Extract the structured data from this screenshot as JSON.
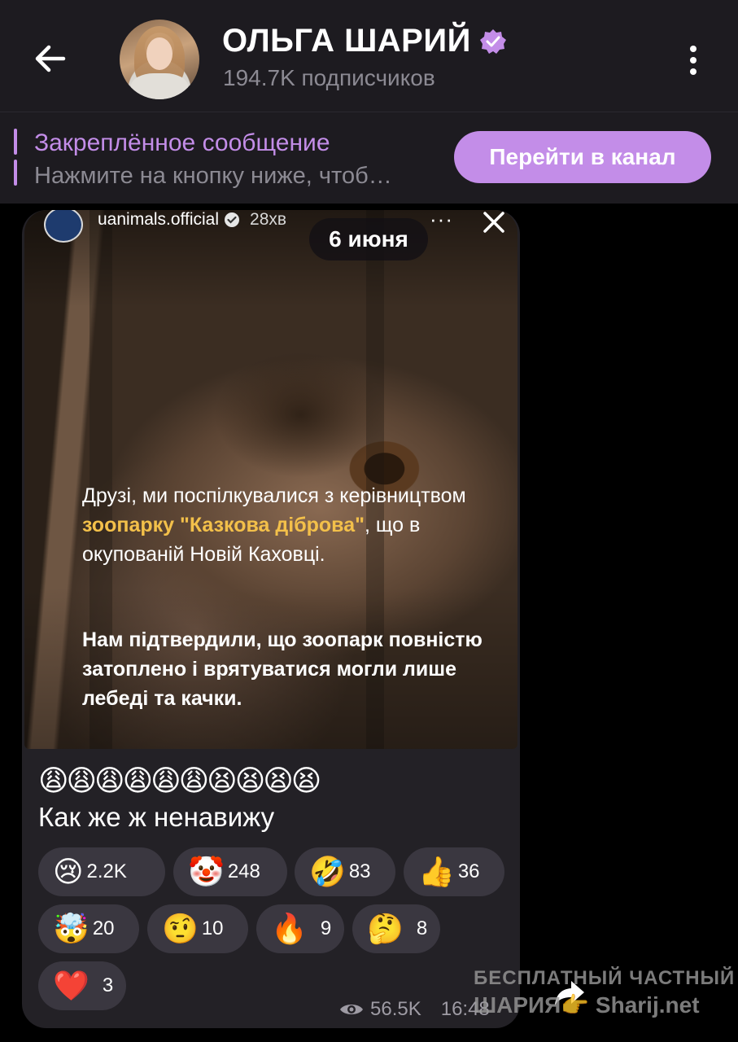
{
  "header": {
    "channel_name": "ОЛЬГА ШАРИЙ",
    "subscribers": "194.7K подписчиков",
    "icons": [
      "back-arrow-icon",
      "verified-badge-icon",
      "more-vertical-icon"
    ]
  },
  "pinned": {
    "title": "Закреплённое сообщение",
    "text": "Нажмите на кнопку ниже, чтоб…",
    "button_label": "Перейти в канал",
    "accent_color": "#c38de8"
  },
  "post": {
    "date_pill": "6 июня",
    "media": {
      "username": "uanimals.official",
      "time": "28хв",
      "menu": "···",
      "paragraph1_part1": "Друзі, ми поспілкувалися з керівництвом ",
      "paragraph1_highlight": "зоопарку \"Казкова діброва\"",
      "paragraph1_part2": ", що в окупованій Новій Каховці.",
      "paragraph2": "Нам підтвердили, що зоопарк повністю затоплено і врятуватися могли лише лебеді та качки.",
      "highlight_color": "#f3c04a"
    },
    "emoji_line": "😩😩😩😩😩😩😫😫😫😫",
    "caption": "Как же ж ненавижу",
    "reactions": [
      {
        "emoji": "😢",
        "count": "2.2K"
      },
      {
        "emoji": "🤡",
        "count": "248"
      },
      {
        "emoji": "🤣",
        "count": "83"
      },
      {
        "emoji": "👍",
        "count": "36"
      },
      {
        "emoji": "🤯",
        "count": "20"
      },
      {
        "emoji": "🤨",
        "count": "10"
      },
      {
        "emoji": "🔥",
        "count": "9"
      },
      {
        "emoji": "🤔",
        "count": "8"
      },
      {
        "emoji": "❤️",
        "count": "3"
      }
    ],
    "views": "56.5K",
    "time": "16:48"
  },
  "watermark": {
    "line1": "БЕСПЛАТНЫЙ  ЧАСТНЫЙ",
    "line2": "ШАРИЯ👉 Sharij.net"
  }
}
